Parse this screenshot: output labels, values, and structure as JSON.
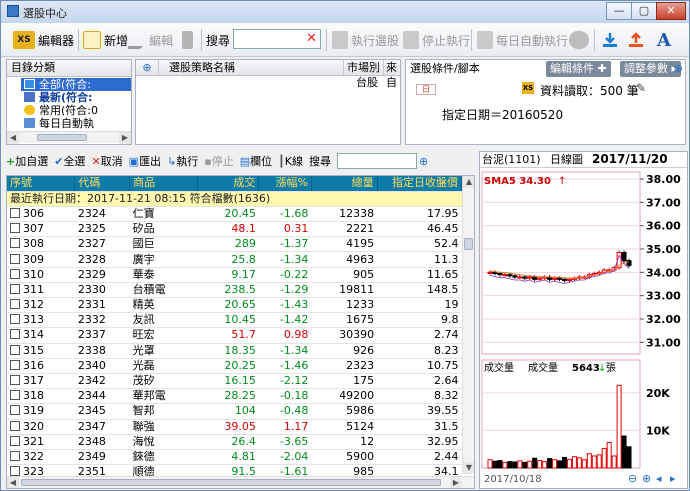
{
  "window": {
    "title": "選股中心",
    "min": "—",
    "max": "▢",
    "close": "✕"
  },
  "toolbar": {
    "editor": "編輯器",
    "new": "新增",
    "edit": "編輯",
    "search_label": "搜尋",
    "run_screen": "執行選股",
    "stop_run": "停止執行",
    "daily_auto": "每日自動執行"
  },
  "dir": {
    "header": "目錄分類",
    "items": [
      "全部(符合:",
      "最新(符合:",
      "常用(符合:0",
      "每日自動執"
    ]
  },
  "strategy": {
    "col_name": "選股策略名稱",
    "col_market": "市場別",
    "col_src": "來",
    "market_value": "台股",
    "src_value": "自"
  },
  "conditions": {
    "header": "選股條件/腳本",
    "edit_btn": "編輯條件",
    "adjust_btn": "調整參數",
    "data_read": "資料讀取：500 筆",
    "date_label": "指定日期＝20160520"
  },
  "gridbar": {
    "add": "加自選",
    "selall": "全選",
    "cancel": "取消",
    "export": "匯出",
    "run": "執行",
    "stop": "停止",
    "cols": "欄位",
    "kline": "K線",
    "search": "搜尋"
  },
  "grid": {
    "headers": [
      "序號",
      "代碼",
      "商品",
      "成交",
      "漲幅%",
      "總量",
      "指定日收盤價"
    ],
    "summary": "最近執行日期：2017-11-21 08:15 符合檔數(1636)",
    "rows": [
      [
        "306",
        "2324",
        "仁寶",
        "20.45",
        "-1.68",
        "12338",
        "17.95",
        "d"
      ],
      [
        "307",
        "2325",
        "矽品",
        "48.1",
        "0.31",
        "2221",
        "46.45",
        "u"
      ],
      [
        "308",
        "2327",
        "國巨",
        "289",
        "-1.37",
        "4195",
        "52.4",
        "d"
      ],
      [
        "309",
        "2328",
        "廣宇",
        "25.8",
        "-1.34",
        "4963",
        "11.3",
        "d"
      ],
      [
        "310",
        "2329",
        "華泰",
        "9.17",
        "-0.22",
        "905",
        "11.65",
        "d"
      ],
      [
        "311",
        "2330",
        "台積電",
        "238.5",
        "-1.29",
        "19811",
        "148.5",
        "d"
      ],
      [
        "312",
        "2331",
        "精英",
        "20.65",
        "-1.43",
        "1233",
        "19",
        "d"
      ],
      [
        "313",
        "2332",
        "友訊",
        "10.45",
        "-1.42",
        "1675",
        "9.8",
        "d"
      ],
      [
        "314",
        "2337",
        "旺宏",
        "51.7",
        "0.98",
        "30390",
        "2.74",
        "u"
      ],
      [
        "315",
        "2338",
        "光罩",
        "18.35",
        "-1.34",
        "926",
        "8.23",
        "d"
      ],
      [
        "316",
        "2340",
        "光磊",
        "20.25",
        "-1.46",
        "2323",
        "10.75",
        "d"
      ],
      [
        "317",
        "2342",
        "茂矽",
        "16.15",
        "-2.12",
        "175",
        "2.64",
        "d"
      ],
      [
        "318",
        "2344",
        "華邦電",
        "28.25",
        "-0.18",
        "49200",
        "8.32",
        "d"
      ],
      [
        "319",
        "2345",
        "智邦",
        "104",
        "-0.48",
        "5986",
        "39.55",
        "d"
      ],
      [
        "320",
        "2347",
        "聯強",
        "39.05",
        "1.17",
        "5124",
        "31.5",
        "u"
      ],
      [
        "321",
        "2348",
        "海悅",
        "26.4",
        "-3.65",
        "12",
        "32.95",
        "d"
      ],
      [
        "322",
        "2349",
        "錸德",
        "4.81",
        "-2.04",
        "5900",
        "2.44",
        "d"
      ],
      [
        "323",
        "2351",
        "順德",
        "91.5",
        "-1.61",
        "985",
        "34.1",
        "d"
      ]
    ]
  },
  "chart": {
    "symbol": "台泥(1101)",
    "period": "日線圖",
    "date": "2017/11/20",
    "sma": "SMA5 34.30",
    "vol_label1": "成交量",
    "vol_label2": "成交量",
    "vol_value": "5643",
    "vol_unit": "張",
    "bottom_date": "2017/10/18",
    "price_ticks": [
      "38.00",
      "37.00",
      "36.00",
      "35.00",
      "34.00",
      "33.00",
      "32.00",
      "31.00"
    ],
    "vol_ticks": [
      "20K",
      "10K"
    ],
    "colors": {
      "up": "#e00000",
      "down": "#000000",
      "sma": "#e07a2a",
      "accent": "#0f7ba7"
    }
  },
  "chart_data": {
    "type": "candlestick",
    "title": "台泥(1101)",
    "ylim": [
      30.5,
      38.3
    ],
    "close": [
      34.0,
      33.95,
      33.9,
      33.9,
      33.85,
      33.8,
      33.8,
      33.75,
      33.8,
      33.7,
      33.75,
      33.8,
      33.7,
      33.75,
      33.7,
      33.65,
      33.7,
      33.75,
      33.8,
      33.8,
      33.9,
      33.95,
      34.0,
      34.1,
      34.1,
      34.2,
      34.85,
      34.5,
      34.3
    ],
    "volume": [
      2200,
      1800,
      2000,
      1500,
      1700,
      1600,
      1900,
      1500,
      1800,
      2600,
      2000,
      1700,
      2500,
      2200,
      1900,
      2800,
      2300,
      3000,
      2700,
      2200,
      3800,
      3200,
      3500,
      5200,
      6800,
      3200,
      22000,
      8500,
      5643
    ]
  }
}
